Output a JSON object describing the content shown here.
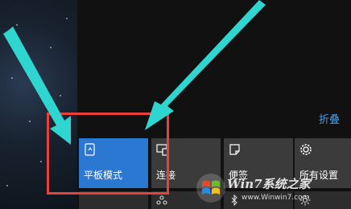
{
  "action_center": {
    "collapse_label": "折叠",
    "tiles": [
      {
        "label": "平板模式",
        "icon": "tablet-mode-icon",
        "active": true
      },
      {
        "label": "连接",
        "icon": "connect-icon",
        "active": false
      },
      {
        "label": "便签",
        "icon": "note-icon",
        "active": false
      },
      {
        "label": "所有设置",
        "icon": "gear-icon",
        "active": false
      }
    ],
    "second_row_icons": [
      "vpn-icon",
      "bluetooth-icon",
      "brightness-icon"
    ]
  },
  "annotations": {
    "highlight_color": "#e8403a",
    "arrow_color": "#2fd6d0"
  },
  "watermark": {
    "text": "Win7系统之家",
    "site": "www.Winwin7.com"
  }
}
